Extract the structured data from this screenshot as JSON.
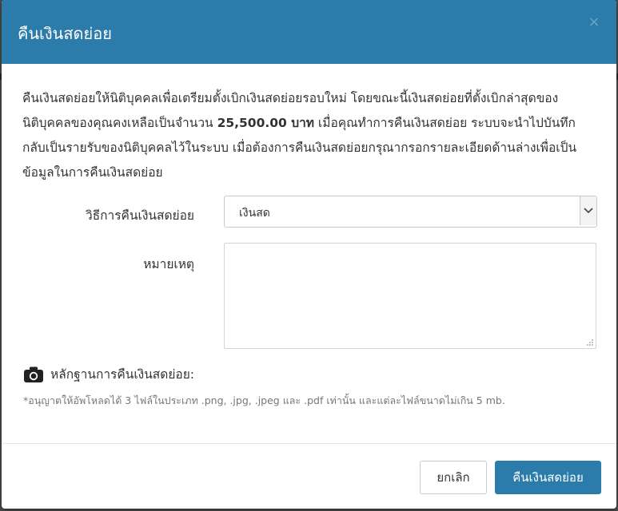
{
  "modal": {
    "title": "คืนเงินสดย่อย",
    "close_label": "×"
  },
  "intro": {
    "text_before": "คืนเงินสดย่อยให้นิติบุคคลเพื่อเตรียมตั้งเบิกเงินสดย่อยรอบใหม่ โดยขณะนี้เงินสดย่อยที่ตั้งเบิกล่าสุดของนิติบุคคลของคุณคงเหลือเป็นจำนวน ",
    "amount": "25,500.00 บาท",
    "text_after": " เมื่อคุณทำการคืนเงินสดย่อย ระบบจะนำไปบันทึกกลับเป็นรายรับของนิติบุคคลไว้ในระบบ เมื่อต้องการคืนเงินสดย่อยกรุณากรอกรายละเอียดด้านล่างเพื่อเป็นข้อมูลในการคืนเงินสดย่อย"
  },
  "form": {
    "method_label": "วิธีการคืนเงินสดย่อย",
    "method_value": "เงินสด",
    "note_label": "หมายเหตุ",
    "note_value": ""
  },
  "evidence": {
    "icon": "camera-icon",
    "label": "หลักฐานการคืนเงินสดย่อย:",
    "hint": "*อนุญาตให้อัพโหลดได้ 3 ไฟล์ในประเภท .png, .jpg, .jpeg และ .pdf เท่านั้น และแต่ละไฟล์ขนาดไม่เกิน 5 mb."
  },
  "buttons": {
    "cancel": "ยกเลิก",
    "submit": "คืนเงินสดย่อย"
  },
  "colors": {
    "header": "#2b7cab",
    "primary_button": "#2b7cab"
  }
}
